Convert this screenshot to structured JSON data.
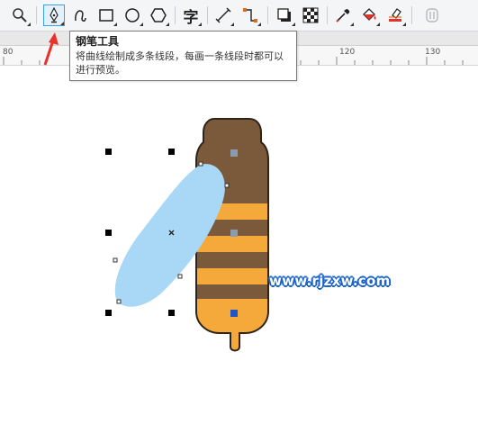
{
  "toolbar": {
    "tools": [
      {
        "name": "zoom-tool",
        "icon": "magnifier-icon"
      },
      {
        "name": "pen-tool",
        "icon": "pen-nib-icon",
        "active": true
      },
      {
        "name": "bspline-tool",
        "icon": "curve-icon"
      },
      {
        "name": "rectangle-tool",
        "icon": "rectangle-icon"
      },
      {
        "name": "ellipse-tool",
        "icon": "ellipse-icon"
      },
      {
        "name": "polygon-tool",
        "icon": "hexagon-icon"
      },
      {
        "name": "text-tool",
        "icon": "text-char-icon",
        "glyph": "字"
      },
      {
        "name": "dimension-tool",
        "icon": "parallel-dimension-icon"
      },
      {
        "name": "connector-tool",
        "icon": "connector-icon"
      },
      {
        "name": "drop-shadow-tool",
        "icon": "drop-shadow-icon"
      },
      {
        "name": "transparency-tool",
        "icon": "checkerboard-icon"
      },
      {
        "name": "eyedropper-tool",
        "icon": "eyedropper-icon"
      },
      {
        "name": "interactive-fill-tool",
        "icon": "paint-bucket-icon"
      },
      {
        "name": "smart-fill-tool",
        "icon": "smart-fill-icon"
      },
      {
        "name": "lock-tool",
        "icon": "disabled-tool-icon"
      }
    ]
  },
  "ruler": {
    "labels": [
      "80",
      "120",
      "130"
    ]
  },
  "tooltip": {
    "title": "钢笔工具",
    "description": "将曲线绘制成多条线段，每画一条线段时都可以进行预览。"
  },
  "canvas": {
    "watermark": "www.rjzxw.com",
    "colors": {
      "bee_body": "#7a5a3a",
      "bee_outline": "#2e2418",
      "bee_stripe": "#f5a93a",
      "wing_fill": "#a8d8f5",
      "node_fill": "#8a9bb0",
      "node_selected": "#1f56c4",
      "watermark_outline": "#1a63c7"
    }
  }
}
